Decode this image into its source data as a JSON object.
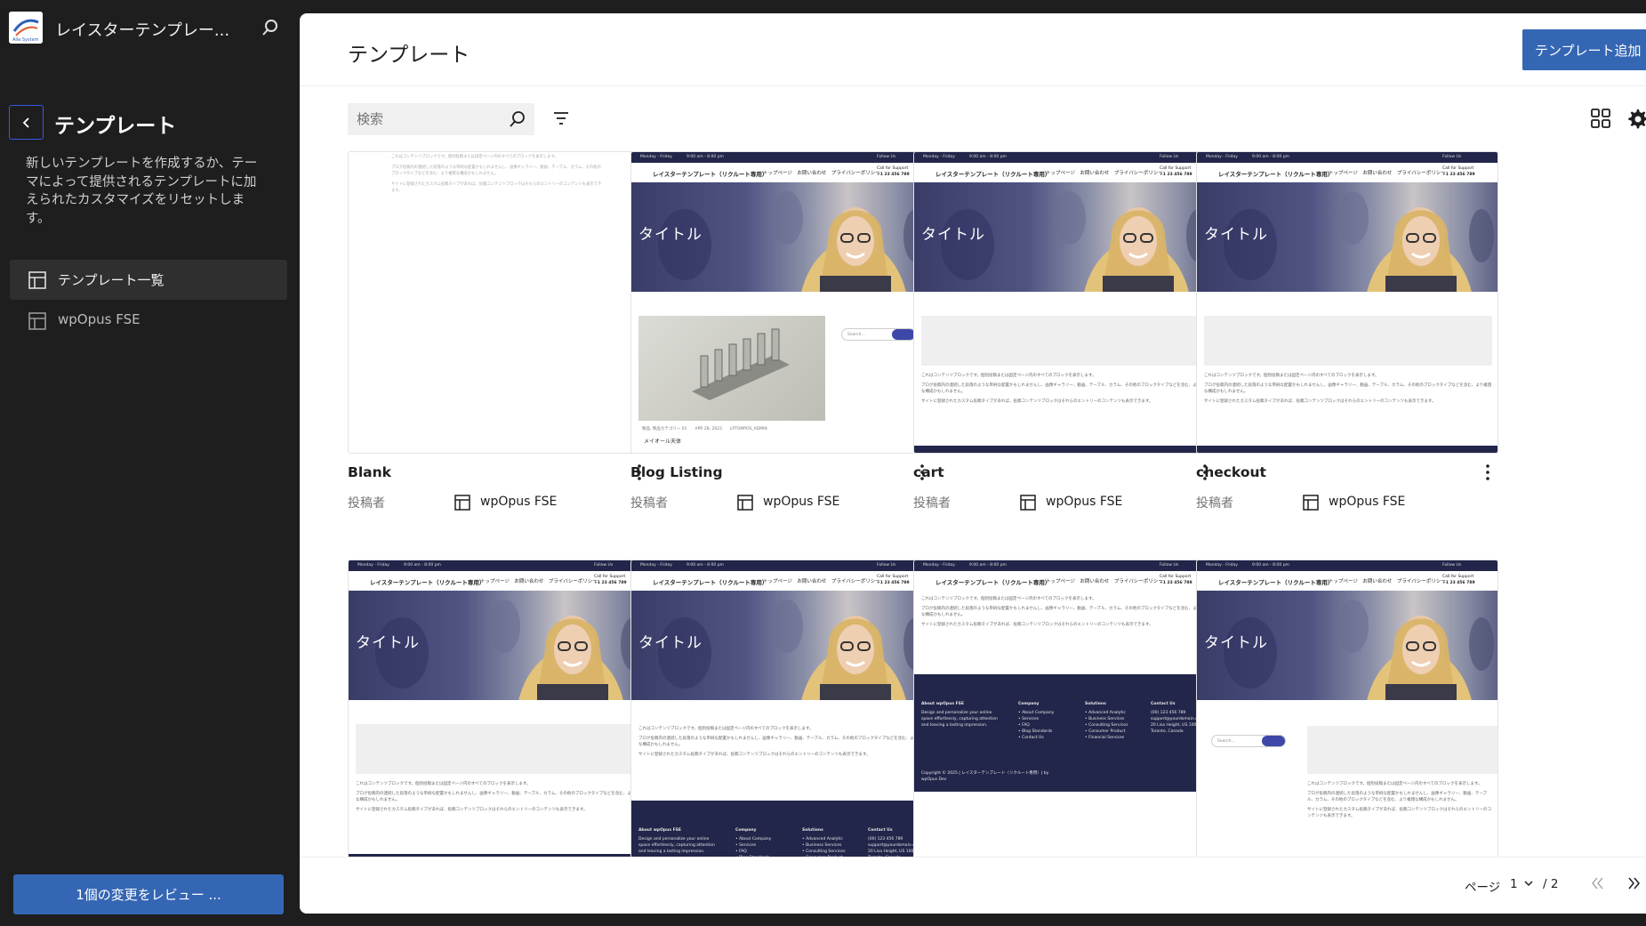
{
  "sidebar": {
    "site_title": "レイスターテンプレー...",
    "logo_text": "Alle System",
    "heading": "テンプレート",
    "description": "新しいテンプレートを作成するか、テーマによって提供されるテンプレートに加えられたカスタマイズをリセットします。",
    "nav": [
      {
        "label": "テンプレート一覧",
        "icon": "layout-icon",
        "active": true
      },
      {
        "label": "wpOpus FSE",
        "icon": "layout-icon",
        "active": false
      }
    ],
    "review_button": "1個の変更をレビュー ..."
  },
  "main": {
    "title": "テンプレート",
    "add_button": "テンプレート追加",
    "search_placeholder": "検索",
    "author_label": "投稿者",
    "author_name": "wpOpus FSE",
    "cards": [
      {
        "name": "Blank",
        "layout": "blank"
      },
      {
        "name": "Blog Listing",
        "layout": "blog"
      },
      {
        "name": "cart",
        "layout": "page"
      },
      {
        "name": "checkout",
        "layout": "page"
      },
      {
        "name": "",
        "layout": "page"
      },
      {
        "name": "",
        "layout": "single"
      },
      {
        "name": "",
        "layout": "nohero"
      },
      {
        "name": "",
        "layout": "search"
      }
    ],
    "pagination": {
      "label": "ページ",
      "current": "1",
      "total": "/ 2"
    }
  },
  "thumbnail_text": {
    "topbar_left": "Monday - Friday",
    "topbar_time": "9:00 am - 8:00 pm",
    "topbar_follow": "Follow Us",
    "site_name": "レイスターテンプレート（リクルート専用）",
    "nav_links": "トップページ　お問い合わせ　プライバシーポリシー",
    "call_label": "Call for Support",
    "call_number": "+1 23 456 789",
    "hero_title": "タイトル",
    "content_1": "これはコンテンツブロックです。個別投稿または固定ページ内のすべてのブロックを表示します。",
    "content_2": "ブログ投稿内の連続した段落のような単純な配置かもしれませんし、画像ギャラリー、動画、テーブル、カラム、その他のブロックタイプなどを含む、より複雑な構成かもしれません。",
    "content_3": "サイトに登録されたカスタム投稿タイプがあれば、投稿コンテンツブロックはそれらのエントリーのコンテンツも表示できます。",
    "blog_meta": "製品, 製品カテゴリー 01　　APR 28, 2023　　LPTOMPOS_ADMIN",
    "blog_excerpt": "メイオール天体",
    "search_placeholder": "Search...",
    "footer_about": "About wpOpus FSE",
    "footer_about_text": "Design and personalize your online space effortlessly, capturing attention and leaving a lasting impression.",
    "footer_company": "Company",
    "footer_company_items": "• About Company\n• Services\n• FAQ\n• Blog Standards\n• Contact Us",
    "footer_solutions": "Solutions",
    "footer_solutions_items": "• Advanced Analytic\n• Business Services\n• Consulting Services\n• Consumer Product\n• Financial Services",
    "footer_contact": "Contact Us",
    "footer_contact_items": "(00) 123 456 789\nsupport@yourdomain.com\n20 Lisa Height, US 1000\nToronto, Canada",
    "footer_copyright": "Copyright © 2025 | レイスターテンプレート（リクルート専用）| by wpOpus Dev"
  }
}
